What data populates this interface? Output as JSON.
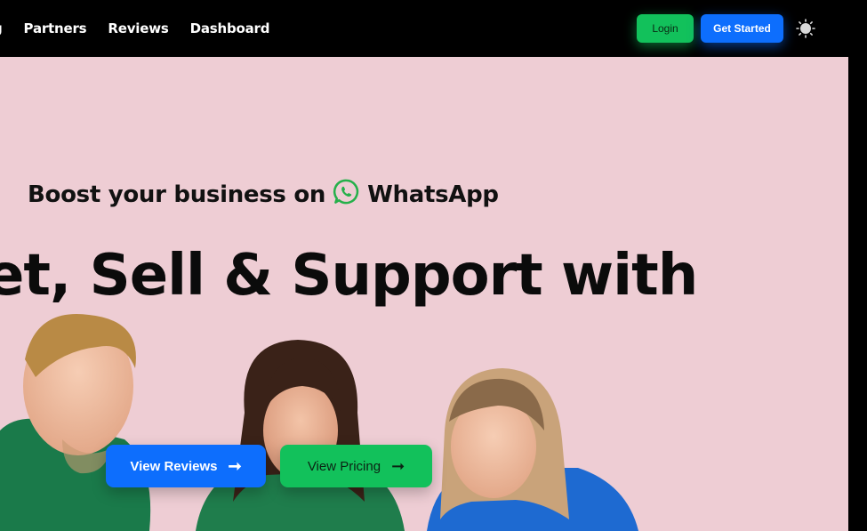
{
  "nav": {
    "links": [
      "g",
      "Partners",
      "Reviews",
      "Dashboard"
    ],
    "login_label": "Login",
    "get_started_label": "Get Started",
    "theme_icon": "sun-icon"
  },
  "hero": {
    "subtitle_prefix": "Boost your business on",
    "subtitle_brand": "WhatsApp",
    "subtitle_icon": "whatsapp-icon",
    "headline": "et, Sell & Support with",
    "buttons": {
      "reviews_label": "View Reviews",
      "pricing_label": "View Pricing",
      "arrow_icon": "arrow-right-icon"
    }
  },
  "colors": {
    "nav_bg": "#000000",
    "hero_bg": "#eecdd4",
    "primary_blue": "#0d6efd",
    "whatsapp_green": "#12c15b"
  }
}
